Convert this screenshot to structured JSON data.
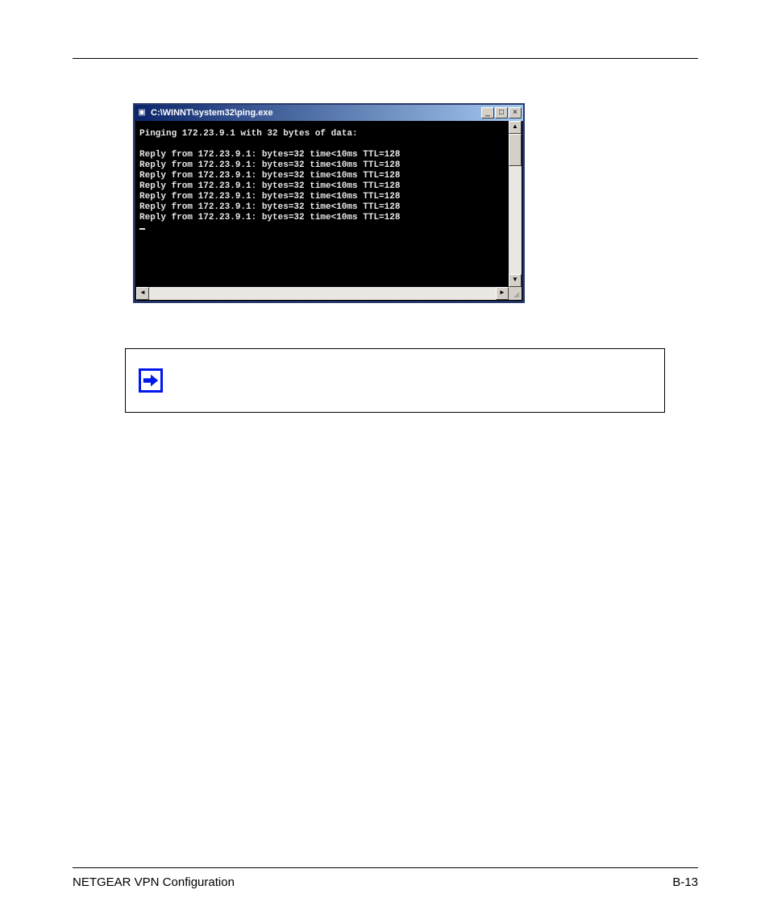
{
  "footer": {
    "left": "NETGEAR VPN Configuration",
    "right": "B-13"
  },
  "console": {
    "title": "C:\\WINNT\\system32\\ping.exe",
    "buttons": {
      "min": "_",
      "max": "□",
      "close": "×"
    },
    "scroll": {
      "up": "▲",
      "down": "▼",
      "left": "◄",
      "right": "►"
    },
    "lines": [
      "Pinging 172.23.9.1 with 32 bytes of data:",
      "",
      "Reply from 172.23.9.1: bytes=32 time<10ms TTL=128",
      "Reply from 172.23.9.1: bytes=32 time<10ms TTL=128",
      "Reply from 172.23.9.1: bytes=32 time<10ms TTL=128",
      "Reply from 172.23.9.1: bytes=32 time<10ms TTL=128",
      "Reply from 172.23.9.1: bytes=32 time<10ms TTL=128",
      "Reply from 172.23.9.1: bytes=32 time<10ms TTL=128",
      "Reply from 172.23.9.1: bytes=32 time<10ms TTL=128"
    ]
  },
  "note": {
    "icon": "arrow-right-icon",
    "text": ""
  }
}
